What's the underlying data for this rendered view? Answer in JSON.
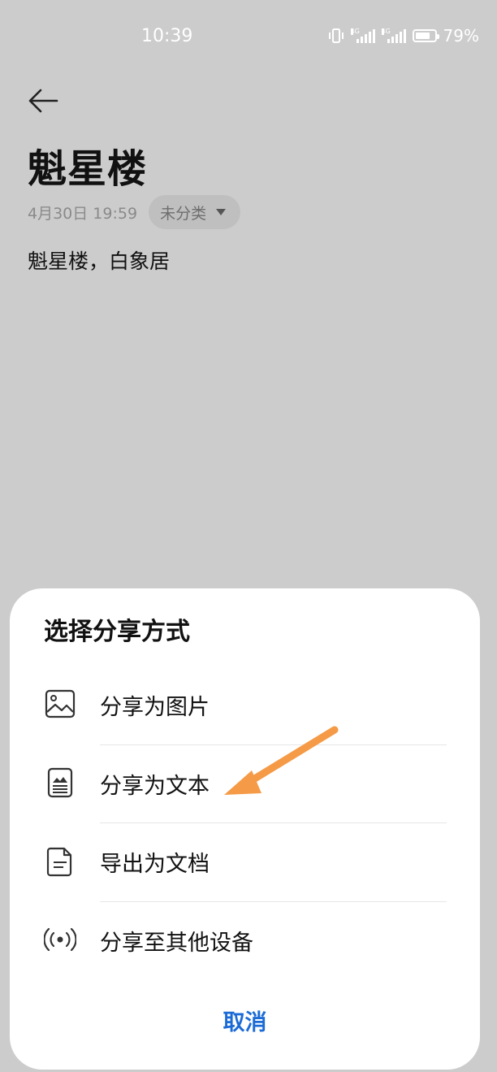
{
  "status_bar": {
    "time": "10:39",
    "signal_labels": [
      "4G",
      "4G"
    ],
    "battery_percent": "79%",
    "battery_level": 0.79
  },
  "note": {
    "title": "魁星楼",
    "date": "4月30日 19:59",
    "category": "未分类",
    "body": "魁星楼，白象居"
  },
  "share_sheet": {
    "title": "选择分享方式",
    "options": [
      {
        "label": "分享为图片",
        "icon": "image-icon"
      },
      {
        "label": "分享为文本",
        "icon": "text-document-icon"
      },
      {
        "label": "导出为文档",
        "icon": "file-icon"
      },
      {
        "label": "分享至其他设备",
        "icon": "broadcast-icon"
      }
    ],
    "cancel_label": "取消"
  },
  "colors": {
    "accent": "#1b6bd6",
    "annotation_arrow": "#f59a46",
    "overlay": "#cccccc"
  }
}
